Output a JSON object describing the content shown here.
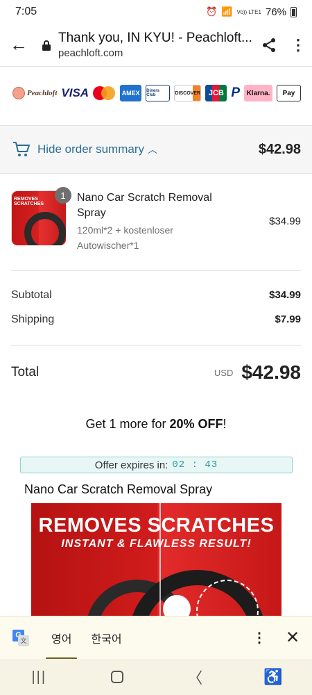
{
  "status": {
    "time": "7:05",
    "network": "Vo)) LTE1",
    "battery": "76%"
  },
  "browser": {
    "title": "Thank you, IN KYU! - Peachloft...",
    "domain": "peachloft.com"
  },
  "payment_logos": {
    "brand": "Peachloft",
    "visa": "VISA",
    "amex": "AMEX",
    "diners": "Diners Club",
    "discover": "DISCOVER",
    "jcb": "JCB",
    "paypal": "P",
    "klarna": "Klarna.",
    "applepay": " Pay"
  },
  "summary": {
    "label": "Hide order summary",
    "total": "$42.98"
  },
  "product": {
    "quantity": "1",
    "name": "Nano Car Scratch Removal Spray",
    "variant": "120ml*2 + kostenloser Autowischer*1",
    "price": "$34.99",
    "thumb_text": "REMOVES SCRATCHES"
  },
  "costs": {
    "subtotal_label": "Subtotal",
    "subtotal_value": "$34.99",
    "shipping_label": "Shipping",
    "shipping_value": "$7.99"
  },
  "total": {
    "label": "Total",
    "currency": "USD",
    "value": "$42.98"
  },
  "upsell": {
    "heading_pre": "Get 1 more for ",
    "heading_bold": "20% OFF",
    "heading_post": "!",
    "offer_label": "Offer expires in:",
    "offer_timer": "02 : 43",
    "product_name": "Nano Car Scratch Removal Spray",
    "promo_title": "REMOVES SCRATCHES",
    "promo_subtitle": "INSTANT & FLAWLESS RESULT!"
  },
  "translate": {
    "tab_english": "영어",
    "tab_korean": "한국어"
  },
  "colors": {
    "link": "#2b6f94",
    "timer": "#2a9b9b",
    "offer_bg": "#e8f6f6"
  }
}
